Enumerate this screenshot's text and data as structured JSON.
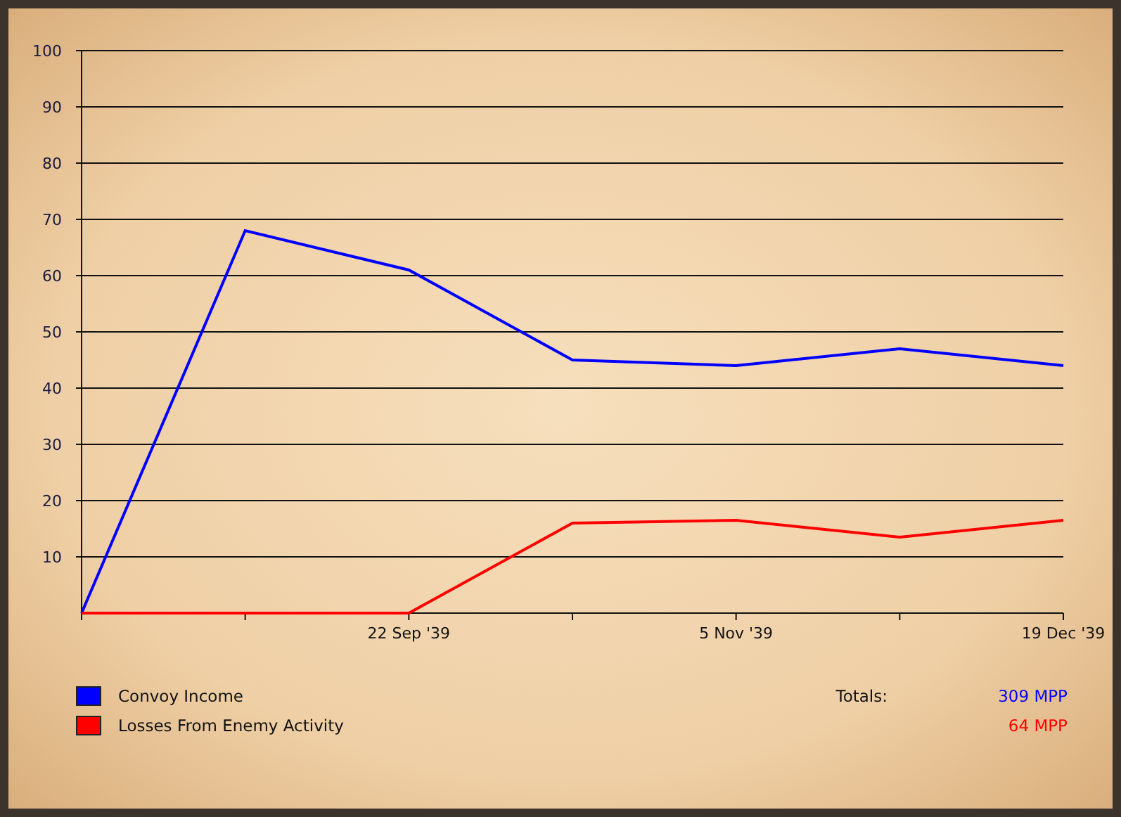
{
  "chart_data": {
    "type": "line",
    "categories": [
      null,
      null,
      "22 Sep '39",
      null,
      "5 Nov '39",
      null,
      "19 Dec '39"
    ],
    "ylim": [
      0,
      100
    ],
    "grid": true,
    "yticks": [
      10,
      20,
      30,
      40,
      50,
      60,
      70,
      80,
      90,
      100
    ],
    "series": [
      {
        "name": "Convoy Income",
        "color": "#0000ff",
        "values": [
          0,
          68,
          61,
          45,
          44,
          47,
          44
        ]
      },
      {
        "name": "Losses From Enemy Activity",
        "color": "#ff0000",
        "values": [
          0,
          0,
          0,
          16,
          16.5,
          13.5,
          16.5
        ]
      }
    ]
  },
  "legend": {
    "totals_label": "Totals:",
    "totals": [
      "309 MPP",
      "64 MPP"
    ]
  }
}
